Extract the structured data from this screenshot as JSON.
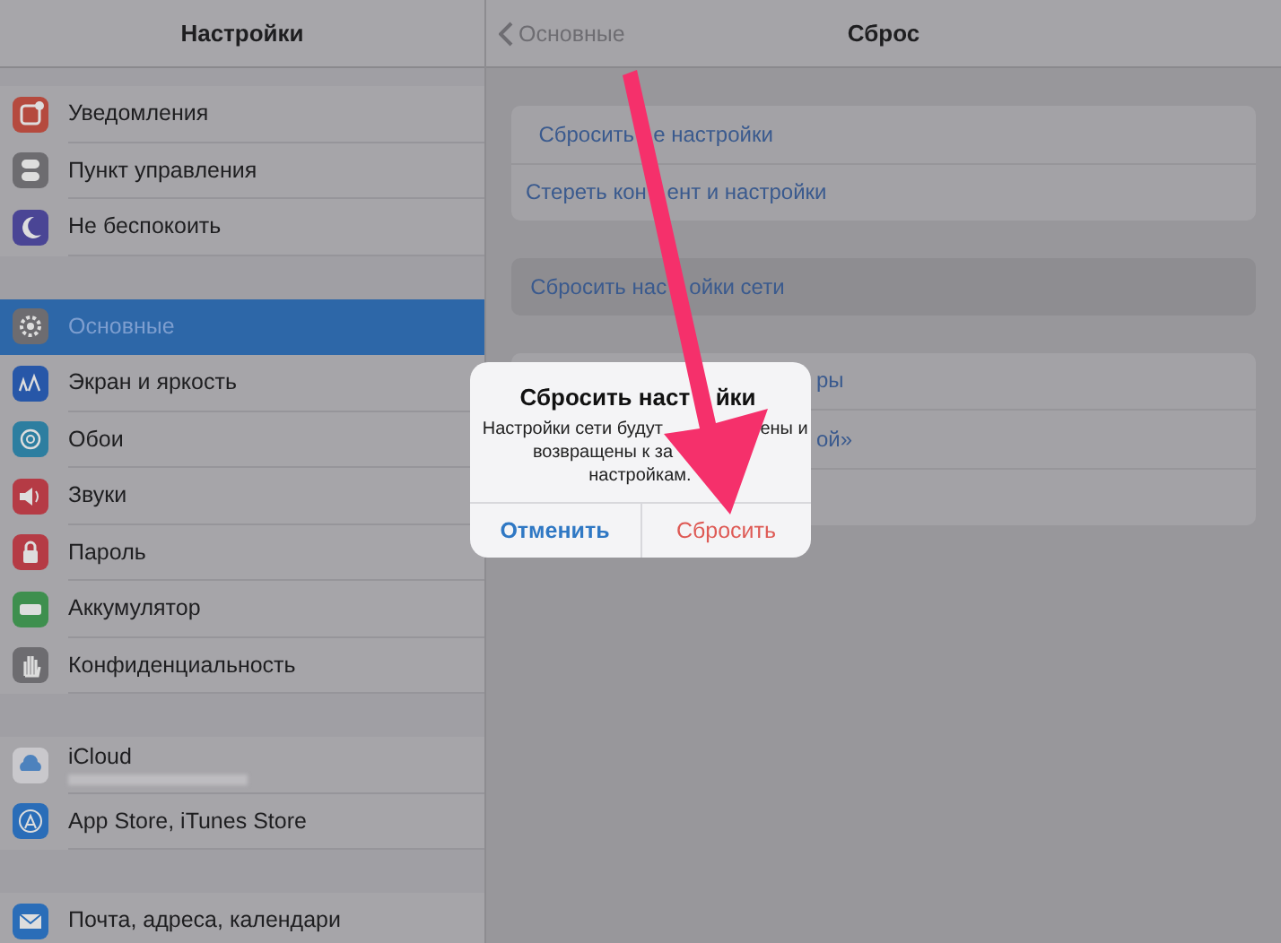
{
  "sidebar": {
    "title": "Настройки",
    "sections": [
      {
        "items": [
          {
            "label": "Уведомления",
            "selected": false,
            "kind": "plain"
          },
          {
            "label": "Пункт управления",
            "selected": false,
            "kind": "plain"
          },
          {
            "label": "Не беспокоить",
            "selected": false,
            "kind": "plain"
          }
        ]
      },
      {
        "items": [
          {
            "label": "Основные",
            "selected": true,
            "kind": "plain"
          },
          {
            "label": "Экран и яркость",
            "selected": false,
            "kind": "plain"
          },
          {
            "label": "Обои",
            "selected": false,
            "kind": "plain"
          },
          {
            "label": "Звуки",
            "selected": false,
            "kind": "plain"
          },
          {
            "label": "Пароль",
            "selected": false,
            "kind": "plain"
          },
          {
            "label": "Аккумулятор",
            "selected": false,
            "kind": "plain"
          },
          {
            "label": "Конфиденциальность",
            "selected": false,
            "kind": "plain"
          }
        ]
      },
      {
        "items": [
          {
            "label": "iCloud",
            "selected": false,
            "kind": "account"
          },
          {
            "label": "App Store, iTunes Store",
            "selected": false,
            "kind": "plain"
          }
        ]
      },
      {
        "items": [
          {
            "label": "Почта, адреса, календари",
            "selected": false,
            "kind": "plain"
          }
        ]
      }
    ]
  },
  "nav": {
    "back": "Основные",
    "title": "Сброс"
  },
  "groups": [
    {
      "rows": [
        {
          "parts": [
            "Сбросить",
            "е настройки"
          ],
          "selected": false
        },
        {
          "parts": [
            "Стереть кон",
            "ент и настройки"
          ],
          "selected": false
        }
      ]
    },
    {
      "rows": [
        {
          "parts": [
            "Сбросить нас",
            "ойки сети"
          ],
          "selected": true
        }
      ]
    },
    {
      "rows": [
        {
          "parts": [
            "ры"
          ],
          "selected": false
        },
        {
          "parts": [
            "ой»"
          ],
          "selected": false
        },
        {
          "selected": false
        }
      ]
    }
  ],
  "alert": {
    "title_parts": [
      "Сбросить наст",
      "йки"
    ],
    "message_lines": [
      {
        "parts": [
          "Настройки сети будут",
          "ены и"
        ]
      },
      {
        "parts": [
          "возвращены к за"
        ]
      },
      {
        "parts": [
          "настройкам."
        ]
      }
    ],
    "buttons": [
      {
        "label": "Отменить",
        "kind": "cancel"
      },
      {
        "label": "Сбросить",
        "kind": "destructive"
      }
    ]
  }
}
